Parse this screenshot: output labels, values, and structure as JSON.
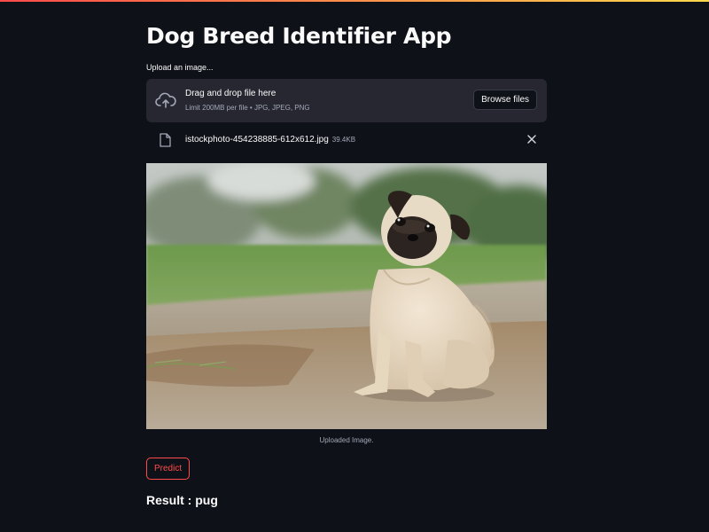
{
  "app": {
    "title": "Dog Breed Identifier App"
  },
  "uploader": {
    "label": "Upload an image...",
    "drop_title": "Drag and drop file here",
    "limit_text": "Limit 200MB per file • JPG, JPEG, PNG",
    "browse_label": "Browse files"
  },
  "file": {
    "name": "istockphoto-454238885-612x612.jpg",
    "size": "39.4KB"
  },
  "image": {
    "caption": "Uploaded Image."
  },
  "actions": {
    "predict_label": "Predict"
  },
  "result": {
    "text": "Result : pug"
  },
  "colors": {
    "background": "#0e1117",
    "panel": "#262730",
    "accent": "#ff4b4b",
    "muted_text": "#a3a8b8"
  },
  "icons": {
    "upload": "cloud-upload-icon",
    "file": "file-icon",
    "close": "close-icon"
  }
}
